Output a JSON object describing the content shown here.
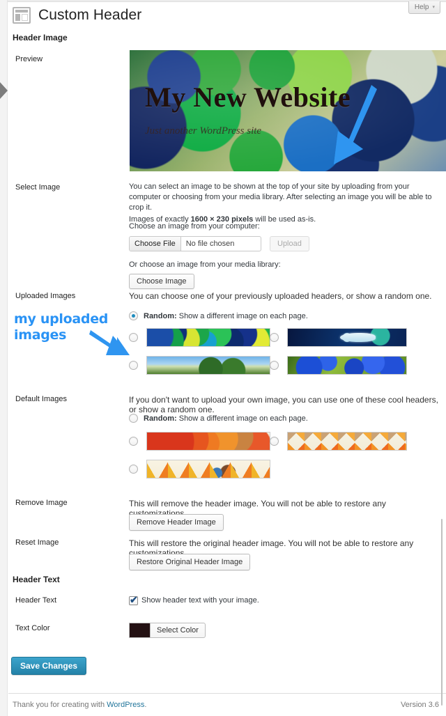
{
  "window": {
    "help_button": "Help",
    "help_caret": "▾"
  },
  "header": {
    "icon": "appearance-layout-icon",
    "title": "Custom Header"
  },
  "sections": {
    "header_image_heading": "Header Image",
    "header_text_heading": "Header Text"
  },
  "preview": {
    "label": "Preview",
    "site_title": "My New Website",
    "tagline": "Just another WordPress site"
  },
  "select_image": {
    "label": "Select Image",
    "description_line1": "You can select an image to be shown at the top of your site by uploading from your computer or choosing from your media library. After selecting an image you will be able to crop it.",
    "description_line2_pre": "Images of exactly ",
    "description_line2_bold": "1600 × 230 pixels",
    "description_line2_post": " will be used as-is.",
    "computer_label": "Choose an image from your computer:",
    "file_button": "Choose File",
    "file_name": "No file chosen",
    "upload_button": "Upload",
    "library_label": "Or choose an image from your media library:",
    "choose_image_button": "Choose Image"
  },
  "uploaded_images": {
    "label": "Uploaded Images",
    "description": "You can choose one of your previously uploaded headers, or show a random one.",
    "random_bold": "Random:",
    "random_text": " Show a different image on each page.",
    "random_selected": true,
    "thumbnails": [
      {
        "name": "bottle-caps-thumbnail",
        "selected": false,
        "style": "t-caps"
      },
      {
        "name": "fish-thumbnail",
        "selected": false,
        "style": "t-fish"
      },
      {
        "name": "field-tree-thumbnail",
        "selected": false,
        "style": "t-field"
      },
      {
        "name": "blue-flowers-thumbnail",
        "selected": false,
        "style": "t-flowers"
      }
    ]
  },
  "default_images": {
    "label": "Default Images",
    "description": "If you don't want to upload your own image, you can use one of these cool headers, or show a random one.",
    "random_bold": "Random:",
    "random_text": " Show a different image on each page.",
    "random_selected": false,
    "thumbnails": [
      {
        "name": "circles-default-thumbnail",
        "selected": false,
        "style": "t-circles"
      },
      {
        "name": "diamonds-default-thumbnail",
        "selected": false,
        "style": "t-diamonds"
      },
      {
        "name": "star-default-thumbnail",
        "selected": false,
        "style": "t-star"
      }
    ]
  },
  "remove_image": {
    "label": "Remove Image",
    "description": "This will remove the header image. You will not be able to restore any customizations.",
    "button": "Remove Header Image"
  },
  "reset_image": {
    "label": "Reset Image",
    "description": "This will restore the original header image. You will not be able to restore any customizations.",
    "button": "Restore Original Header Image"
  },
  "header_text": {
    "label": "Header Text",
    "checkbox_label": "Show header text with your image.",
    "checked": true
  },
  "text_color": {
    "label": "Text Color",
    "swatch_hex": "#241113",
    "button": "Select Color"
  },
  "save": {
    "button": "Save Changes"
  },
  "footer": {
    "thanks_pre": "Thank you for creating with ",
    "link": "WordPress",
    "thanks_post": ".",
    "version": "Version 3.6"
  },
  "annotations": {
    "uploaded_images_note_line1": "my uploaded",
    "uploaded_images_note_line2": "images",
    "note_color": "#2a93f5",
    "arrow_color": "#2f95f0"
  }
}
